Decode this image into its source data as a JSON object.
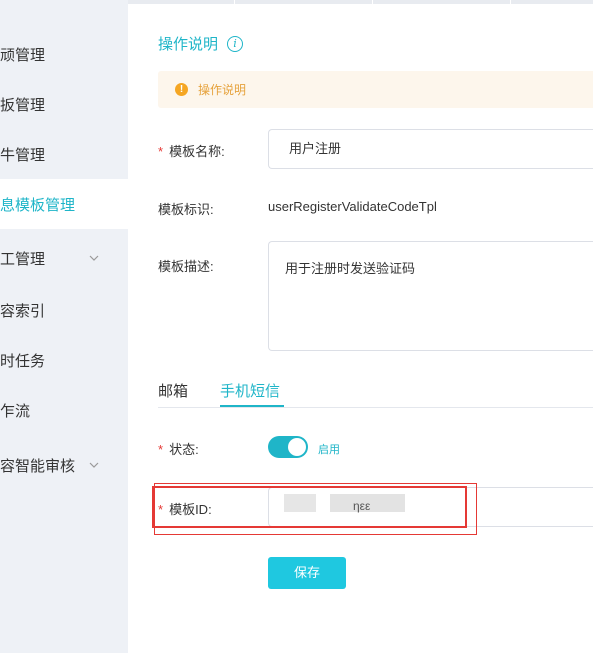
{
  "sidebar": {
    "items": [
      {
        "label": "顽管理"
      },
      {
        "label": "扳管理"
      },
      {
        "label": "牛管理"
      },
      {
        "label": "息模板管理"
      },
      {
        "label": "工管理"
      },
      {
        "label": "容索引"
      },
      {
        "label": "时任务"
      },
      {
        "label": "乍流"
      },
      {
        "label": "容智能审核"
      }
    ]
  },
  "page": {
    "title": "操作说明",
    "notice": "操作说明"
  },
  "form": {
    "name_label": "模板名称:",
    "name_value": "用户注册",
    "code_label": "模板标识:",
    "code_value": "userRegisterValidateCodeTpl",
    "desc_label": "模板描述:",
    "desc_value": "用于注册时发送验证码",
    "status_label": "状态:",
    "status_text": "启用",
    "template_id_label": "模板ID:",
    "template_id_visible": "ηεε",
    "save_label": "保存",
    "required_mark": "*"
  },
  "tabs": [
    {
      "label": "邮箱"
    },
    {
      "label": "手机短信"
    }
  ],
  "colors": {
    "accent": "#1fb5c8",
    "notice_bg": "#fdf6ec",
    "notice_text": "#e6a23c",
    "required": "#e53935",
    "highlight_box": "#e53935"
  }
}
